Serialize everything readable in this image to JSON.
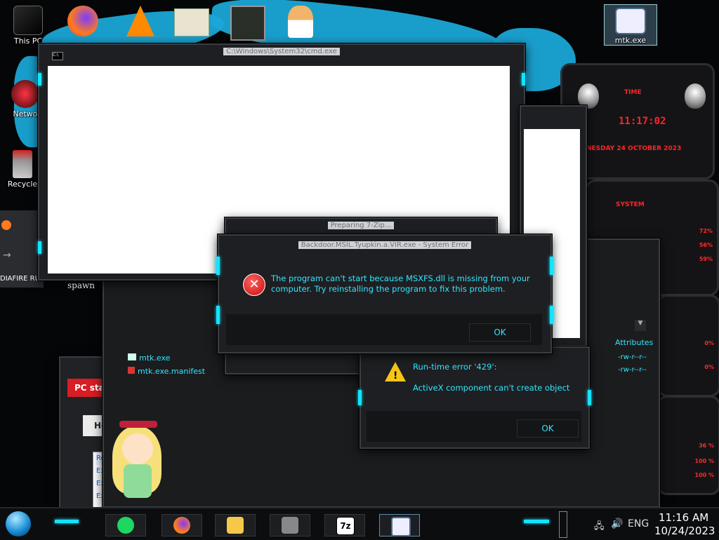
{
  "desktop": {
    "icons": [
      {
        "label": "This PC"
      },
      {
        "label": "Netwo"
      },
      {
        "label": "Recycle"
      },
      {
        "label": "mtk.exe"
      }
    ]
  },
  "cmd_window": {
    "title": "C:\\Windows\\System32\\cmd.exe"
  },
  "zip_window": {
    "title": "Preparing 7-Zip..."
  },
  "system_error": {
    "title": "Backdoor.MSIL.Tyupkin.a.VIR.exe - System Error",
    "message": "The program can't start because MSXFS.dll is missing from your computer. Try reinstalling the program to fix this problem.",
    "ok_label": "OK"
  },
  "runtime_error": {
    "line1": "Run-time error '429':",
    "line2": "ActiveX component can't create object",
    "ok_label": "OK"
  },
  "explorer_fragment": {
    "files": [
      "mtk.exe",
      "mtk.exe.manifest"
    ],
    "attributes_header": "Attributes",
    "attributes": [
      "-rw-r--r--",
      "-rw-r--r--"
    ],
    "spawn_text": "spawn"
  },
  "left_panel": {
    "header": "PC sta",
    "home_tab": "Hom",
    "list": [
      "Rea",
      "Ex",
      "Ex",
      "Excl",
      "Adv"
    ],
    "diafire": "DIAFIRE RU"
  },
  "gadget": {
    "time_label": "TIME",
    "time_value": "11:17:02",
    "date_value": "NESDAY 24 OCTOBER 2023",
    "system_label": "SYSTEM",
    "cpu_values": [
      "72%",
      "56%",
      "59%"
    ],
    "disk_values": [
      "0%",
      "0%"
    ],
    "net_values": [
      "36 %",
      "100 %",
      "100 %"
    ]
  },
  "taskbar": {
    "language": "ENG",
    "time": "11:16 AM",
    "date": "10/24/2023",
    "apps": [
      "spotify-icon",
      "firefox-icon",
      "file-explorer-icon",
      "wall-icon",
      "7zip-icon",
      "mtk-icon"
    ],
    "seven_zip_label": "7z"
  },
  "colors": {
    "accent": "#13e3ff",
    "error_red": "#d81d24",
    "gadget_red": "#ff2525"
  }
}
